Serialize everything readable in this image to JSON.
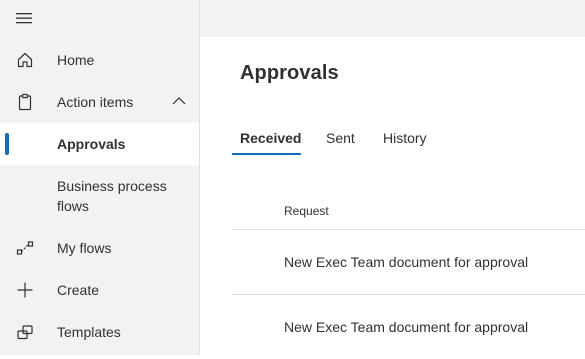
{
  "sidebar": {
    "items": [
      {
        "label": "Home",
        "icon": "home-icon"
      },
      {
        "label": "Action items",
        "icon": "clipboard-icon"
      },
      {
        "label": "Approvals"
      },
      {
        "label_line1": "Business process",
        "label_line2": "flows"
      },
      {
        "label": "My flows",
        "icon": "flow-icon"
      },
      {
        "label": "Create",
        "icon": "plus-icon"
      },
      {
        "label": "Templates",
        "icon": "templates-icon"
      }
    ],
    "active": "Approvals"
  },
  "main": {
    "title": "Approvals",
    "tabs": [
      {
        "label": "Received"
      },
      {
        "label": "Sent"
      },
      {
        "label": "History"
      }
    ],
    "active_tab": "Received",
    "table": {
      "header": "Request",
      "rows": [
        {
          "request": "New Exec Team document for approval"
        },
        {
          "request": "New Exec Team document for approval"
        }
      ]
    }
  },
  "colors": {
    "accent": "#0f6cbd",
    "sidebar_bg": "#f3f2f1",
    "text": "#323130"
  }
}
